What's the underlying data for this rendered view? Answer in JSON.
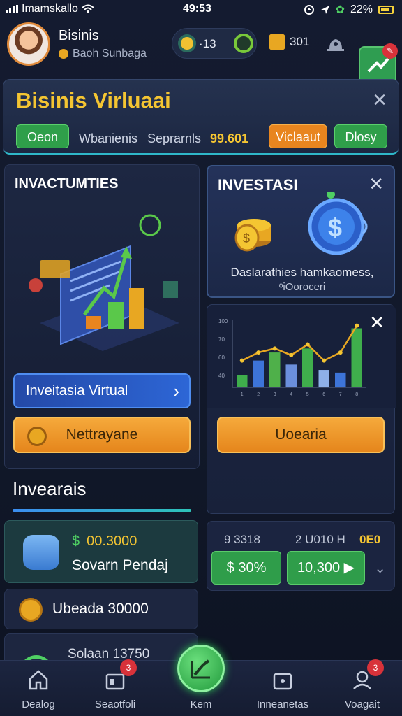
{
  "status_bar": {
    "carrier": "Imamskallo",
    "time": "49:53",
    "battery": "22%"
  },
  "header": {
    "user_name": "Bisinis",
    "user_sub": "Baoh Sunbaga",
    "pill_value": "·13",
    "bag_value": "301"
  },
  "banner": {
    "title": "Bisinis Virluaai",
    "btn_left": "Oeon",
    "label1": "Wbanienis",
    "label2": "Seprarnls",
    "amount": "99.601",
    "btn_orange": "Viclaaut",
    "btn_right": "Dlosy"
  },
  "left_panel": {
    "heading": "INVACTUMTIES",
    "invest_button": "Inveitasia Virtual",
    "action_button": "Nettrayane"
  },
  "right_panel_top": {
    "heading": "INVESTASI",
    "desc1": "Daslarathies hamkaomess,",
    "desc2": "ᵒiOoroceri"
  },
  "right_panel_chart": {
    "button": "Uoearia",
    "y_ticks": [
      "100",
      "70",
      "60",
      "40"
    ]
  },
  "chart_data": {
    "type": "bar",
    "categories": [
      "1",
      "2",
      "3",
      "4",
      "5",
      "6",
      "7",
      "8"
    ],
    "series": [
      {
        "values": [
          18,
          40,
          52,
          34,
          58,
          26,
          22,
          88
        ]
      },
      {
        "values": [
          40,
          52,
          58,
          48,
          64,
          40,
          52,
          92
        ]
      }
    ],
    "ylim": [
      0,
      100
    ]
  },
  "section": {
    "title": "Invearais"
  },
  "cards": {
    "card1_amount": "00.3000",
    "card1_label": "Sovarn Pendaj",
    "card2_label": "Ubeada 30000",
    "card3_label": "Solaan 13750"
  },
  "right_row": {
    "label1": "9 3318",
    "label2": "2 U010 H",
    "label3": "0E0",
    "btn1": "30%",
    "btn2": "10,300"
  },
  "nav": {
    "items": [
      {
        "label": "Dealog"
      },
      {
        "label": "Seaotfoli",
        "badge": "3"
      },
      {
        "label": "Kem"
      },
      {
        "label": "Inneanetas"
      },
      {
        "label": "Voagait",
        "badge": "3"
      }
    ]
  },
  "colors": {
    "accent": "#f4c532",
    "green": "#2f9d4a",
    "orange": "#e8851f",
    "blue": "#2d66d6",
    "badge": "#d8323a"
  }
}
